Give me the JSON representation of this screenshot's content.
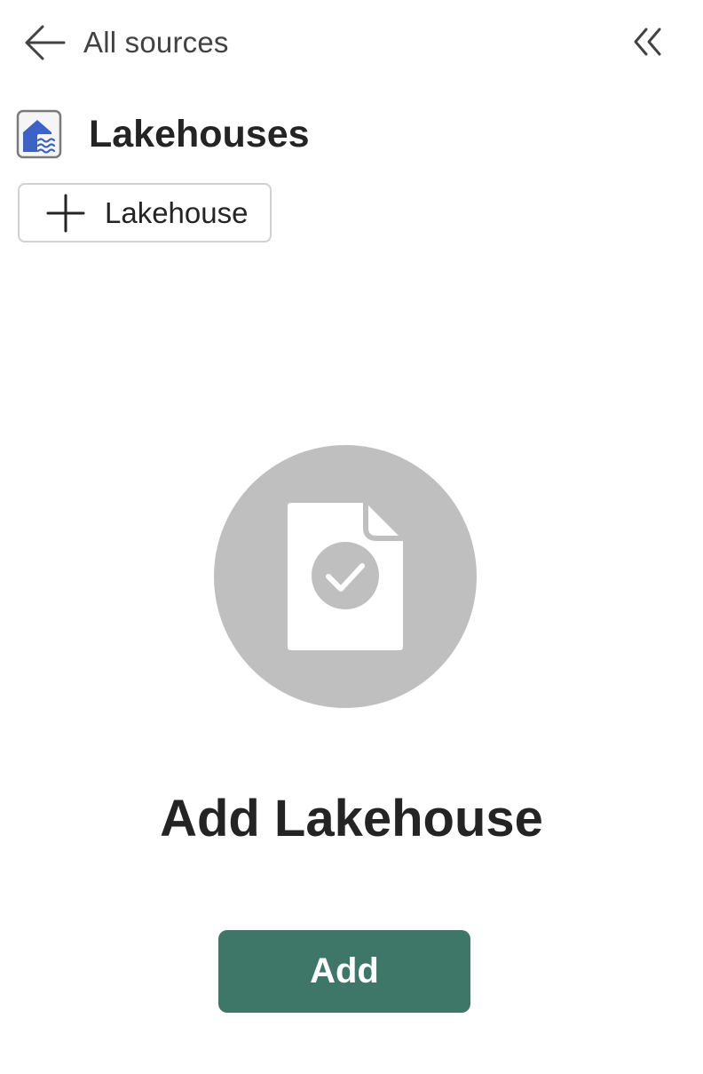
{
  "header": {
    "back_label": "All sources",
    "back_icon": "arrow-left-icon",
    "collapse_icon": "double-chevron-left-icon"
  },
  "section": {
    "title": "Lakehouses",
    "icon": "lakehouse-icon"
  },
  "toolbar": {
    "new_label": "Lakehouse",
    "new_icon": "plus-icon"
  },
  "empty_state": {
    "illustration": "document-check-icon",
    "title": "Add Lakehouse",
    "button_label": "Add"
  },
  "colors": {
    "accent": "#3e7767",
    "illustration_gray": "#bfbfbf",
    "lakehouse_blue": "#3b62c4"
  }
}
